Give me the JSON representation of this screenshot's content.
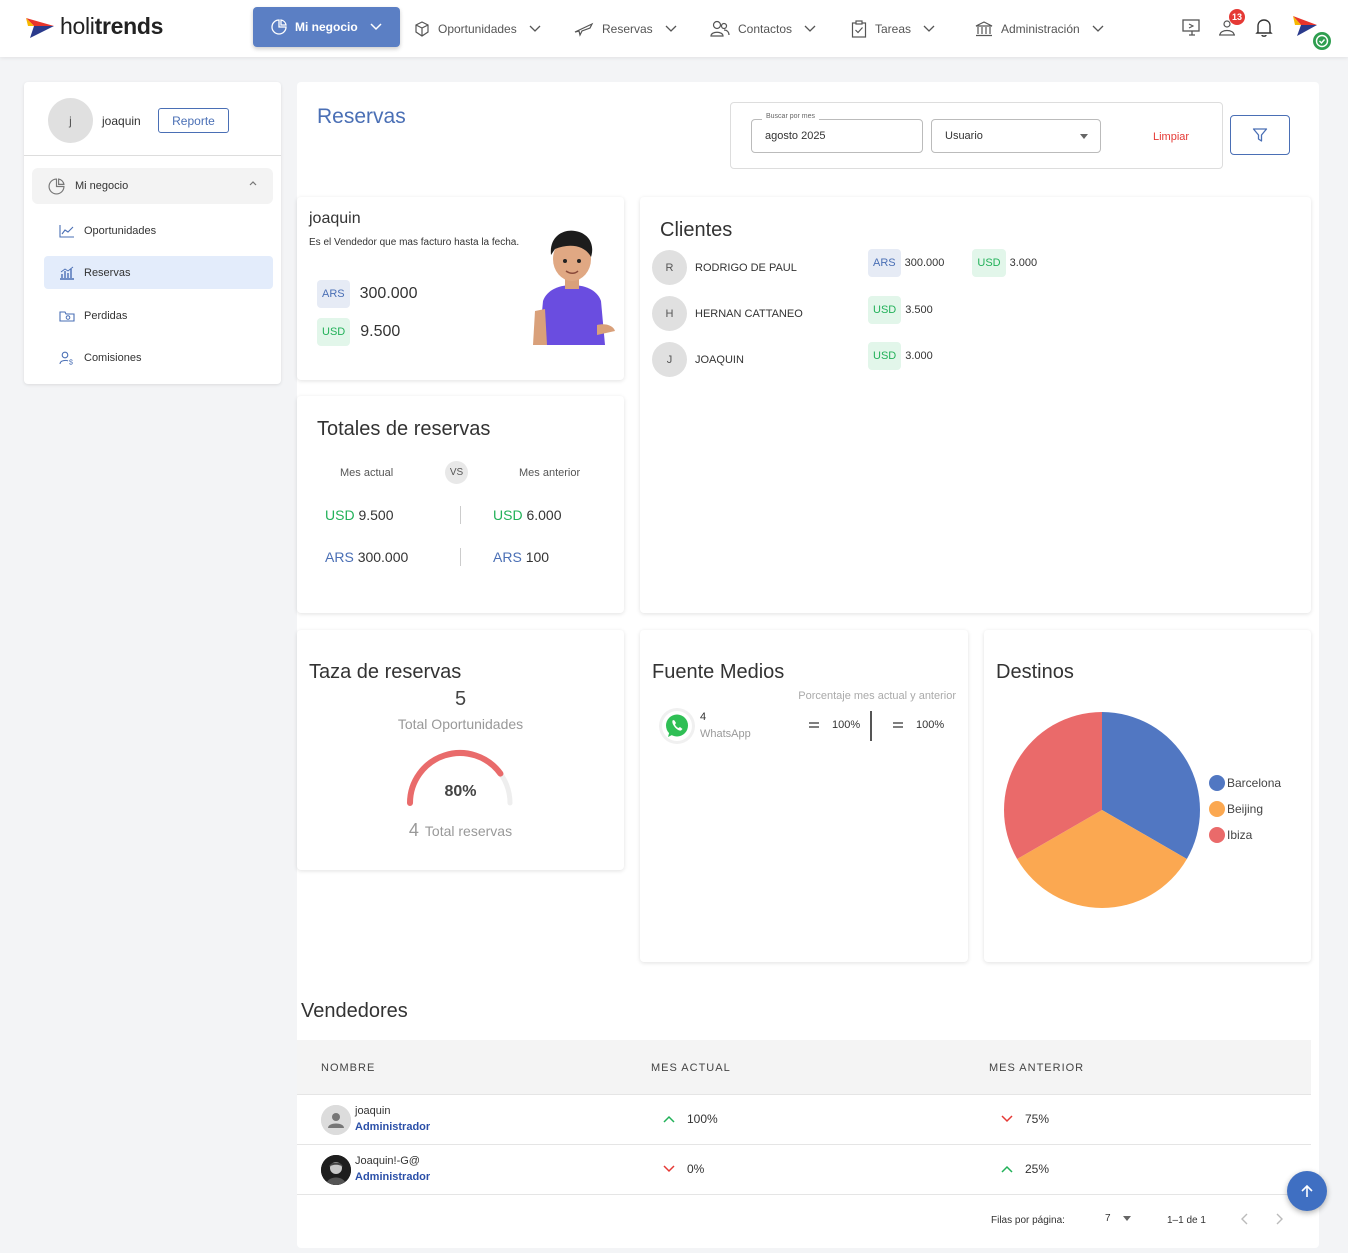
{
  "app": {
    "logo_text_light": "holi",
    "logo_text_bold": "trends"
  },
  "nav": {
    "items": [
      {
        "label": "Mi negocio"
      },
      {
        "label": "Oportunidades"
      },
      {
        "label": "Reservas"
      },
      {
        "label": "Contactos"
      },
      {
        "label": "Tareas"
      },
      {
        "label": "Administración"
      }
    ],
    "notification_badge": "13"
  },
  "sidebar": {
    "avatar_initial": "j",
    "user_name": "joaquin",
    "report_button": "Reporte",
    "group_label": "Mi negocio",
    "items": [
      {
        "label": "Oportunidades"
      },
      {
        "label": "Reservas"
      },
      {
        "label": "Perdidas"
      },
      {
        "label": "Comisiones"
      }
    ]
  },
  "page": {
    "title": "Reservas",
    "search_month_label": "Buscar por mes",
    "search_month_value": "agosto 2025",
    "user_select_value": "Usuario",
    "clear_label": "Limpiar"
  },
  "top_performer": {
    "name": "joaquin",
    "description": "Es el Vendedor que mas facturo hasta la fecha.",
    "rows": [
      {
        "currency": "ARS",
        "amount": "300.000"
      },
      {
        "currency": "USD",
        "amount": "9.500"
      }
    ]
  },
  "totals": {
    "title": "Totales de reservas",
    "current_label": "Mes actual",
    "vs_label": "VS",
    "previous_label": "Mes anterior",
    "usd_current_cur": "USD",
    "usd_current": "9.500",
    "usd_previous_cur": "USD",
    "usd_previous": "6.000",
    "ars_current_cur": "ARS",
    "ars_current": "300.000",
    "ars_previous_cur": "ARS",
    "ars_previous": "100"
  },
  "clients": {
    "title": "Clientes",
    "rows": [
      {
        "initial": "R",
        "name": "RODRIGO DE PAUL",
        "amounts": [
          {
            "currency": "ARS",
            "value": "300.000"
          },
          {
            "currency": "USD",
            "value": "3.000"
          }
        ]
      },
      {
        "initial": "H",
        "name": "HERNAN CATTANEO",
        "amounts": [
          {
            "currency": "USD",
            "value": "3.500"
          }
        ]
      },
      {
        "initial": "J",
        "name": "JOAQUIN",
        "amounts": [
          {
            "currency": "USD",
            "value": "3.000"
          }
        ]
      }
    ]
  },
  "rate": {
    "title": "Taza de reservas",
    "total_opportunities": "5",
    "total_opportunities_label": "Total Oportunidades",
    "percent_label": "80%",
    "percent_value": 0.8,
    "total_bookings": "4",
    "total_bookings_label": "Total reservas",
    "gauge_color": "#e96b6b"
  },
  "sources": {
    "title": "Fuente Medios",
    "percent_header": "Porcentaje mes actual y anterior",
    "items": [
      {
        "icon": "whatsapp-icon",
        "count": "4",
        "label": "WhatsApp",
        "current_pct": "100%",
        "previous_pct": "100%"
      }
    ]
  },
  "chart_data": {
    "type": "pie",
    "title": "Destinos",
    "slices": [
      {
        "label": "Barcelona",
        "value": 1,
        "color": "#5177c2"
      },
      {
        "label": "Beijing",
        "value": 1,
        "color": "#fba851"
      },
      {
        "label": "Ibiza",
        "value": 1,
        "color": "#ea6a6a"
      }
    ],
    "legend_position": "right"
  },
  "sellers": {
    "title": "Vendedores",
    "columns": [
      "NOMBRE",
      "MES ACTUAL",
      "MES ANTERIOR"
    ],
    "rows": [
      {
        "name": "joaquin",
        "role": "Administrador",
        "current": "100%",
        "current_trend": "up",
        "previous": "75%",
        "previous_trend": "down"
      },
      {
        "name": "Joaquin!-G@",
        "role": "Administrador",
        "current": "0%",
        "current_trend": "down",
        "previous": "25%",
        "previous_trend": "up"
      }
    ],
    "rows_per_page_label": "Filas por página:",
    "rows_per_page": "7",
    "range_label": "1–1 de 1"
  },
  "colors": {
    "accent": "#4a6fb5",
    "usd": "#22b159",
    "danger": "#e53935"
  }
}
